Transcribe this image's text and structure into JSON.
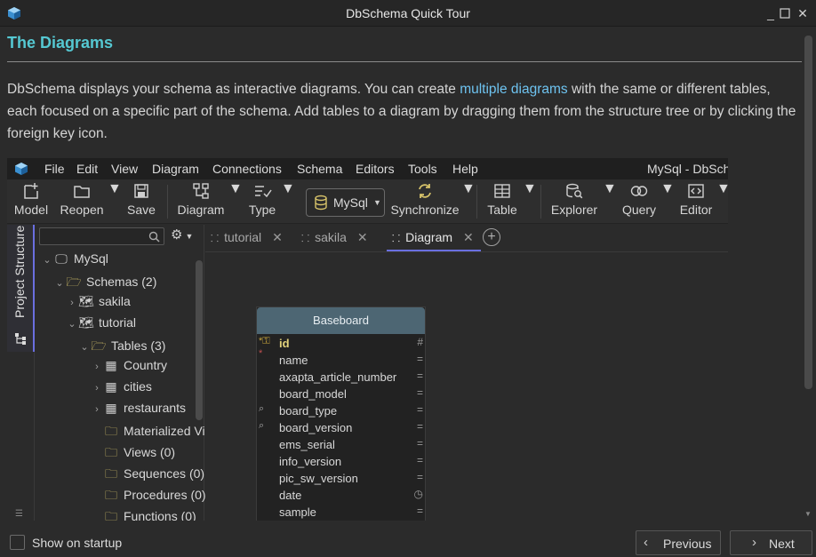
{
  "window": {
    "title": "DbSchema Quick Tour"
  },
  "page": {
    "heading": "The Diagrams",
    "desc_part1": "DbSchema displays your schema as interactive diagrams. You can create ",
    "desc_link": "multiple diagrams",
    "desc_part2": " with the same or different tables, each focused on a specific part of the schema. Add tables to a diagram by dragging them from the structure tree or by clicking the foreign key icon."
  },
  "app": {
    "menu": [
      "File",
      "Edit",
      "View",
      "Diagram",
      "Connections",
      "Schema",
      "Editors",
      "Tools",
      "Help"
    ],
    "title_fragment": "MySql - DbSch",
    "toolbar": {
      "model": "Model",
      "reopen": "Reopen",
      "save": "Save",
      "diagram": "Diagram",
      "type": "Type",
      "connection": "MySql",
      "synchronize": "Synchronize",
      "table": "Table",
      "explorer": "Explorer",
      "query": "Query",
      "editor": "Editor"
    },
    "side_tab": "Project Structure",
    "tree": [
      {
        "label": "MySql",
        "icon": "connection-icon"
      },
      {
        "label": "Schemas (2)",
        "icon": "folder-open-icon"
      },
      {
        "label": "sakila",
        "icon": "schema-icon"
      },
      {
        "label": "tutorial",
        "icon": "schema-icon"
      },
      {
        "label": "Tables (3)",
        "icon": "folder-open-icon"
      },
      {
        "label": "Country",
        "icon": "table-icon"
      },
      {
        "label": "cities",
        "icon": "table-icon"
      },
      {
        "label": "restaurants",
        "icon": "table-icon"
      },
      {
        "label": "Materialized Vi",
        "icon": "folder-icon"
      },
      {
        "label": "Views (0)",
        "icon": "folder-icon"
      },
      {
        "label": "Sequences (0)",
        "icon": "folder-icon"
      },
      {
        "label": "Procedures (0)",
        "icon": "folder-icon"
      },
      {
        "label": "Functions (0)",
        "icon": "folder-icon"
      }
    ],
    "tabs": [
      {
        "label": "tutorial"
      },
      {
        "label": "sakila"
      },
      {
        "label": "Diagram"
      }
    ],
    "entity": {
      "name": "Baseboard",
      "columns": [
        {
          "name": "id",
          "type_icon": "#"
        },
        {
          "name": "name",
          "type_icon": "="
        },
        {
          "name": "axapta_article_number",
          "type_icon": "="
        },
        {
          "name": "board_model",
          "type_icon": "="
        },
        {
          "name": "board_type",
          "type_icon": "="
        },
        {
          "name": "board_version",
          "type_icon": "="
        },
        {
          "name": "ems_serial",
          "type_icon": "="
        },
        {
          "name": "info_version",
          "type_icon": "="
        },
        {
          "name": "pic_sw_version",
          "type_icon": "="
        },
        {
          "name": "date",
          "type_icon": "clock"
        },
        {
          "name": "sample",
          "type_icon": "="
        }
      ]
    }
  },
  "footer": {
    "show_on_startup": "Show on startup",
    "previous": "Previous",
    "next": "Next"
  },
  "colors": {
    "heading": "#55c8d2",
    "link": "#6ec3f0",
    "accent": "#6a6fe0",
    "entity_header": "#4d6673"
  }
}
